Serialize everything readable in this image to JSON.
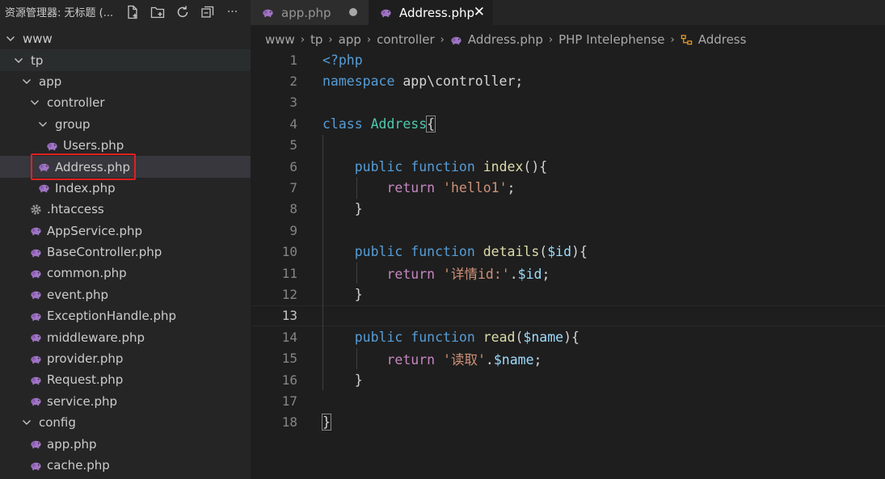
{
  "explorer": {
    "title": "资源管理器: 无标题 (...",
    "actions": [
      "new-file-icon",
      "new-folder-icon",
      "refresh-icon",
      "collapse-all-icon",
      "more-icon"
    ],
    "more_label": "···",
    "tree": [
      {
        "label": "www",
        "type": "folder",
        "expanded": true,
        "depth": 0
      },
      {
        "label": "tp",
        "type": "folder",
        "expanded": true,
        "depth": 1
      },
      {
        "label": "app",
        "type": "folder",
        "expanded": true,
        "depth": 2
      },
      {
        "label": "controller",
        "type": "folder",
        "expanded": true,
        "depth": 3
      },
      {
        "label": "group",
        "type": "folder",
        "expanded": true,
        "depth": 4
      },
      {
        "label": "Users.php",
        "type": "php",
        "depth": 5
      },
      {
        "label": "Address.php",
        "type": "php",
        "depth": 4,
        "selected": true
      },
      {
        "label": "Index.php",
        "type": "php",
        "depth": 4
      },
      {
        "label": ".htaccess",
        "type": "gear",
        "depth": 3
      },
      {
        "label": "AppService.php",
        "type": "php",
        "depth": 3
      },
      {
        "label": "BaseController.php",
        "type": "php",
        "depth": 3
      },
      {
        "label": "common.php",
        "type": "php",
        "depth": 3
      },
      {
        "label": "event.php",
        "type": "php",
        "depth": 3
      },
      {
        "label": "ExceptionHandle.php",
        "type": "php",
        "depth": 3
      },
      {
        "label": "middleware.php",
        "type": "php",
        "depth": 3
      },
      {
        "label": "provider.php",
        "type": "php",
        "depth": 3
      },
      {
        "label": "Request.php",
        "type": "php",
        "depth": 3
      },
      {
        "label": "service.php",
        "type": "php",
        "depth": 3
      },
      {
        "label": "config",
        "type": "folder",
        "expanded": true,
        "depth": 2
      },
      {
        "label": "app.php",
        "type": "php",
        "depth": 3
      },
      {
        "label": "cache.php",
        "type": "php",
        "depth": 3
      }
    ]
  },
  "tabs": [
    {
      "label": "app.php",
      "active": false,
      "modified": true
    },
    {
      "label": "Address.php",
      "active": true,
      "close": "✕"
    }
  ],
  "breadcrumb": {
    "items": [
      "www",
      "tp",
      "app",
      "controller",
      "Address.php",
      "PHP Intelephense",
      "Address"
    ],
    "separator": "›"
  },
  "editor": {
    "current_line": 13,
    "lines": [
      {
        "n": "1",
        "tokens": [
          {
            "t": "<?php",
            "c": "kw"
          }
        ]
      },
      {
        "n": "2",
        "tokens": [
          {
            "t": "namespace",
            "c": "kw"
          },
          {
            "t": " app\\controller;",
            "c": "pl"
          }
        ]
      },
      {
        "n": "3",
        "tokens": []
      },
      {
        "n": "4",
        "tokens": [
          {
            "t": "class",
            "c": "kw"
          },
          {
            "t": " ",
            "c": "pl"
          },
          {
            "t": "Address",
            "c": "cls"
          },
          {
            "t": "{",
            "c": "pl",
            "box": true
          }
        ]
      },
      {
        "n": "5",
        "tokens": []
      },
      {
        "n": "6",
        "tokens": [
          {
            "t": "    ",
            "c": "pl"
          },
          {
            "t": "public",
            "c": "kw"
          },
          {
            "t": " ",
            "c": "pl"
          },
          {
            "t": "function",
            "c": "kw"
          },
          {
            "t": " ",
            "c": "pl"
          },
          {
            "t": "index",
            "c": "fn"
          },
          {
            "t": "(){",
            "c": "pl"
          }
        ]
      },
      {
        "n": "7",
        "tokens": [
          {
            "t": "        ",
            "c": "pl"
          },
          {
            "t": "return",
            "c": "ctl"
          },
          {
            "t": " ",
            "c": "pl"
          },
          {
            "t": "'hello1'",
            "c": "str"
          },
          {
            "t": ";",
            "c": "pl"
          }
        ]
      },
      {
        "n": "8",
        "tokens": [
          {
            "t": "    }",
            "c": "pl"
          }
        ]
      },
      {
        "n": "9",
        "tokens": []
      },
      {
        "n": "10",
        "tokens": [
          {
            "t": "    ",
            "c": "pl"
          },
          {
            "t": "public",
            "c": "kw"
          },
          {
            "t": " ",
            "c": "pl"
          },
          {
            "t": "function",
            "c": "kw"
          },
          {
            "t": " ",
            "c": "pl"
          },
          {
            "t": "details",
            "c": "fn"
          },
          {
            "t": "(",
            "c": "pl"
          },
          {
            "t": "$id",
            "c": "var"
          },
          {
            "t": "){",
            "c": "pl"
          }
        ]
      },
      {
        "n": "11",
        "tokens": [
          {
            "t": "        ",
            "c": "pl"
          },
          {
            "t": "return",
            "c": "ctl"
          },
          {
            "t": " ",
            "c": "pl"
          },
          {
            "t": "'详情id:'",
            "c": "str"
          },
          {
            "t": ".",
            "c": "pl"
          },
          {
            "t": "$id",
            "c": "var"
          },
          {
            "t": ";",
            "c": "pl"
          }
        ]
      },
      {
        "n": "12",
        "tokens": [
          {
            "t": "    }",
            "c": "pl"
          }
        ]
      },
      {
        "n": "13",
        "tokens": []
      },
      {
        "n": "14",
        "tokens": [
          {
            "t": "    ",
            "c": "pl"
          },
          {
            "t": "public",
            "c": "kw"
          },
          {
            "t": " ",
            "c": "pl"
          },
          {
            "t": "function",
            "c": "kw"
          },
          {
            "t": " ",
            "c": "pl"
          },
          {
            "t": "read",
            "c": "fn"
          },
          {
            "t": "(",
            "c": "pl"
          },
          {
            "t": "$name",
            "c": "var"
          },
          {
            "t": "){",
            "c": "pl"
          }
        ]
      },
      {
        "n": "15",
        "tokens": [
          {
            "t": "        ",
            "c": "pl"
          },
          {
            "t": "return",
            "c": "ctl"
          },
          {
            "t": " ",
            "c": "pl"
          },
          {
            "t": "'读取'",
            "c": "str"
          },
          {
            "t": ".",
            "c": "pl"
          },
          {
            "t": "$name",
            "c": "var"
          },
          {
            "t": ";",
            "c": "pl"
          }
        ]
      },
      {
        "n": "16",
        "tokens": [
          {
            "t": "    }",
            "c": "pl"
          }
        ]
      },
      {
        "n": "17",
        "tokens": []
      },
      {
        "n": "18",
        "tokens": [
          {
            "t": "}",
            "c": "pl",
            "box": true
          }
        ]
      }
    ]
  },
  "colors": {
    "php_icon": "#a074c4",
    "selection_outline": "#e02020",
    "keyword": "#569cd6",
    "control": "#c586c0",
    "class": "#4ec9b0",
    "function": "#dcdcaa",
    "string": "#ce9178",
    "variable": "#9cdcfe"
  }
}
